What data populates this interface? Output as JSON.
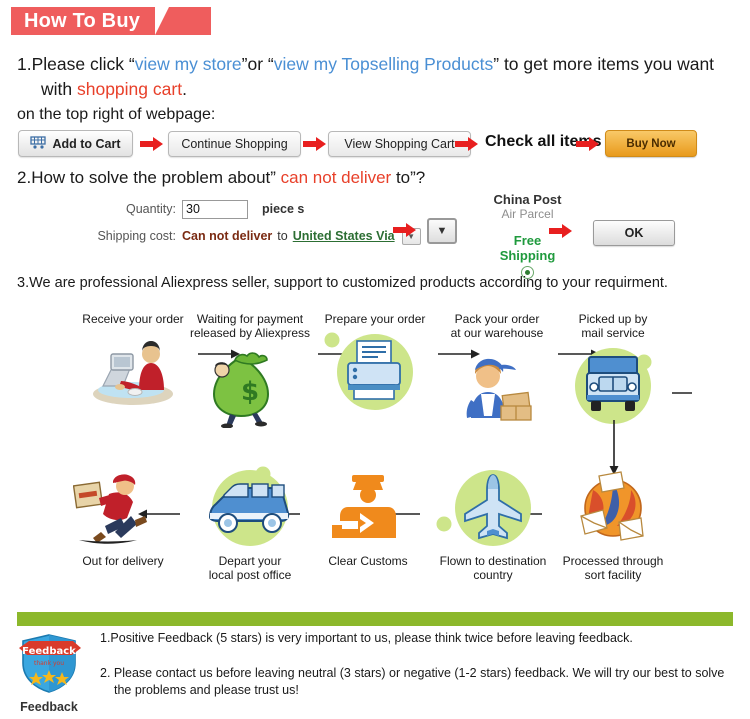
{
  "header": {
    "title": "How To Buy",
    "banner_color": "#ef5d5d"
  },
  "step1": {
    "number": "1.",
    "text_a": "Please click “",
    "link1": "view my store",
    "text_b": "”or “",
    "link2": "view my Topselling Products",
    "text_c": "” to get  more items you want",
    "line2_a": "with ",
    "line2_red": "shopping cart",
    "line2_b": ".",
    "subline": "on the top right of webpage:"
  },
  "buttons": {
    "add_to_cart": "Add to Cart",
    "cart_icon": "shopping-cart-icon",
    "continue_shopping": "Continue Shopping",
    "view_shopping_cart": "View Shopping Cart",
    "check_all_items": "Check all items",
    "buy_now": "Buy Now",
    "buy_now_color": "#e89a1c"
  },
  "step2": {
    "number": "2.",
    "text_a": "How to solve the problem about” ",
    "red": "can not deliver",
    "text_b": " to”?",
    "quantity_label": "Quantity:",
    "quantity_value": "30",
    "quantity_unit": "piece s",
    "shipping_label": "Shipping cost:",
    "shipping_status": "Can not deliver",
    "shipping_to": "to",
    "shipping_country": "United States Via",
    "dropdown_icon": "chevron-down-icon",
    "carrier_line1": "China Post",
    "carrier_line2": "Air Parcel",
    "free_line1": "Free",
    "free_line2": "Shipping",
    "radio_icon": "radio-selected-icon",
    "ok_label": "OK"
  },
  "step3": {
    "number": "3",
    "text": ".We are professional Aliexpress seller, support to customized products according to your requirment."
  },
  "flow": {
    "blob_color": "#cde58a",
    "top": [
      {
        "label": "Receive your order",
        "icon": "person-at-computer-icon",
        "blob": false
      },
      {
        "label": "Waiting for payment\nreleased by Aliexpress",
        "icon": "money-bag-icon",
        "blob": false
      },
      {
        "label": "Prepare your order",
        "icon": "printer-icon",
        "blob": true
      },
      {
        "label": "Pack your order\nat our warehouse",
        "icon": "worker-packing-boxes-icon",
        "blob": false
      },
      {
        "label": "Picked up by\nmail service",
        "icon": "delivery-truck-icon",
        "blob": true
      }
    ],
    "bottom": [
      {
        "label": "Out for delivery",
        "icon": "running-courier-icon",
        "blob": false
      },
      {
        "label": "Depart your\nlocal post office",
        "icon": "delivery-van-icon",
        "blob": true
      },
      {
        "label": "Clear Customs",
        "icon": "customs-officer-icon",
        "blob": false
      },
      {
        "label": "Flown to destination\ncountry",
        "icon": "airplane-icon",
        "blob": true
      },
      {
        "label": "Processed through\nsort facility",
        "icon": "globe-mail-icon",
        "blob": false
      }
    ]
  },
  "feedback": {
    "bar_color": "#8cb82b",
    "badge_icon": "feedback-shield-icon",
    "badge_ribbon": "Feedback",
    "badge_sub": "thank you",
    "badge_caption": "Feedback",
    "line1": "1.Positive Feedback (5 stars) is very important to us, please think twice before leaving feedback.",
    "line2a": "2. Please contact us before leaving neutral (3 stars) or negative (1-2 stars) feedback. We will try our best to solve",
    "line2b": "the problems and please trust us!"
  }
}
